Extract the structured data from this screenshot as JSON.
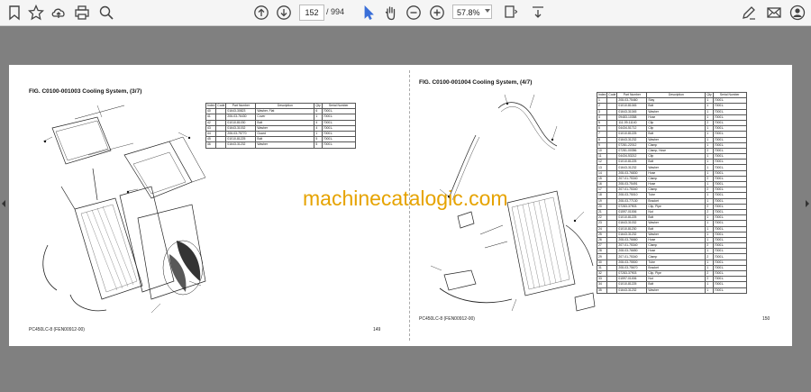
{
  "toolbar": {
    "page_current": "152",
    "page_total": "/ 994",
    "zoom": "57.8%"
  },
  "left_page": {
    "title": "FIG. C0100-001003    Cooling System, (3/7)",
    "footer": "PC450LC-8 (FEN00912-00)",
    "page_number": "149",
    "headers": [
      "Index",
      "Code",
      "Part Number",
      "Description",
      "Qty",
      "Serial Number"
    ],
    "rows": [
      [
        "40",
        "",
        "01643-30823",
        "Washer, Flat",
        "6",
        "70001-"
      ],
      [
        "41",
        "",
        "206-03-76430",
        "Cover",
        "1",
        "70001-"
      ],
      [
        "42",
        "",
        "01010-81030",
        "Bolt",
        "4",
        "70001-"
      ],
      [
        "43",
        "",
        "01643-31032",
        "Washer",
        "4",
        "70001-"
      ],
      [
        "44",
        "",
        "206-03-75770",
        "Guard",
        "1",
        "70001-"
      ],
      [
        "45",
        "",
        "01010-81225",
        "Bolt",
        "5",
        "70001-"
      ],
      [
        "46",
        "",
        "01643-31232",
        "Washer",
        "5",
        "70001-"
      ]
    ]
  },
  "right_page": {
    "title": "FIG. C0100-001004    Cooling System, (4/7)",
    "footer": "PC450LC-8 (FEN00912-00)",
    "page_number": "150",
    "headers": [
      "Index",
      "Code",
      "Part Number",
      "Description",
      "Qty",
      "Serial Number"
    ],
    "rows": [
      [
        "1",
        "",
        "208-03-75460",
        "Stay",
        "1",
        "70001-"
      ],
      [
        "2",
        "",
        "01010-81045",
        "Bolt",
        "1",
        "70001-"
      ],
      [
        "3",
        "",
        "01643-31045",
        "Washer",
        "1",
        "70001-"
      ],
      [
        "4",
        "",
        "09483-10358",
        "Hose",
        "1",
        "70001-"
      ],
      [
        "5",
        "",
        "111-09-11140",
        "Clip",
        "2",
        "70001-"
      ],
      [
        "6",
        "",
        "04434-51712",
        "Clip",
        "1",
        "70001-"
      ],
      [
        "7",
        "",
        "01010-81225",
        "Bolt",
        "1",
        "70001-"
      ],
      [
        "8",
        "",
        "01643-31232",
        "Washer",
        "1",
        "70001-"
      ],
      [
        "9",
        "",
        "07281-22012",
        "Clamp",
        "1",
        "70001-"
      ],
      [
        "10",
        "",
        "07281-00356",
        "Clamp, Hose",
        "2",
        "70001-"
      ],
      [
        "11",
        "",
        "04434-53212",
        "Clip",
        "1",
        "70001-"
      ],
      [
        "12",
        "",
        "01010-81225",
        "Bolt",
        "1",
        "70001-"
      ],
      [
        "13",
        "",
        "01643-31232",
        "Washer",
        "1",
        "70001-"
      ],
      [
        "14",
        "",
        "208-03-76830",
        "Hose",
        "1",
        "70001-"
      ],
      [
        "15",
        "",
        "207-01-75340",
        "Clamp",
        "2",
        "70001-"
      ],
      [
        "16",
        "",
        "208-03-75491",
        "Hose",
        "1",
        "70001-"
      ],
      [
        "17",
        "",
        "207-01-75340",
        "Clamp",
        "2",
        "70001-"
      ],
      [
        "18",
        "",
        "208-03-75010",
        "Tube",
        "1",
        "70001-"
      ],
      [
        "19",
        "",
        "208-03-77130",
        "Bracket",
        "1",
        "70001-"
      ],
      [
        "20",
        "",
        "07283-37903",
        "Clip, Pipe",
        "2",
        "70001-"
      ],
      [
        "21",
        "",
        "01597-01006",
        "Nut",
        "2",
        "70001-"
      ],
      [
        "22",
        "",
        "01010-81225",
        "Bolt",
        "1",
        "70001-"
      ],
      [
        "23",
        "",
        "01643-31032",
        "Washer",
        "1",
        "70001-"
      ],
      [
        "24",
        "",
        "01010-81230",
        "Bolt",
        "1",
        "70001-"
      ],
      [
        "25",
        "",
        "01643-31232",
        "Washer",
        "1",
        "70001-"
      ],
      [
        "26",
        "",
        "208-03-76660",
        "Hose",
        "1",
        "70001-"
      ],
      [
        "27",
        "",
        "207-01-75340",
        "Clamp",
        "2",
        "70001-"
      ],
      [
        "28",
        "",
        "208-03-76650",
        "Hose",
        "1",
        "70001-"
      ],
      [
        "29",
        "",
        "207-01-75340",
        "Clamp",
        "2",
        "70001-"
      ],
      [
        "30",
        "",
        "208-03-75500",
        "Tube",
        "1",
        "70001-"
      ],
      [
        "31",
        "",
        "208-03-75670",
        "Bracket",
        "1",
        "70001-"
      ],
      [
        "32",
        "",
        "07283-37903",
        "Clip, Pipe",
        "2",
        "70001-"
      ],
      [
        "33",
        "",
        "01597-01006",
        "Nut",
        "2",
        "70001-"
      ],
      [
        "34",
        "",
        "01010-81225",
        "Bolt",
        "1",
        "70001-"
      ],
      [
        "35",
        "",
        "01643-31232",
        "Washer",
        "1",
        "70001-"
      ]
    ]
  },
  "watermark": "machinecatalogic.com"
}
